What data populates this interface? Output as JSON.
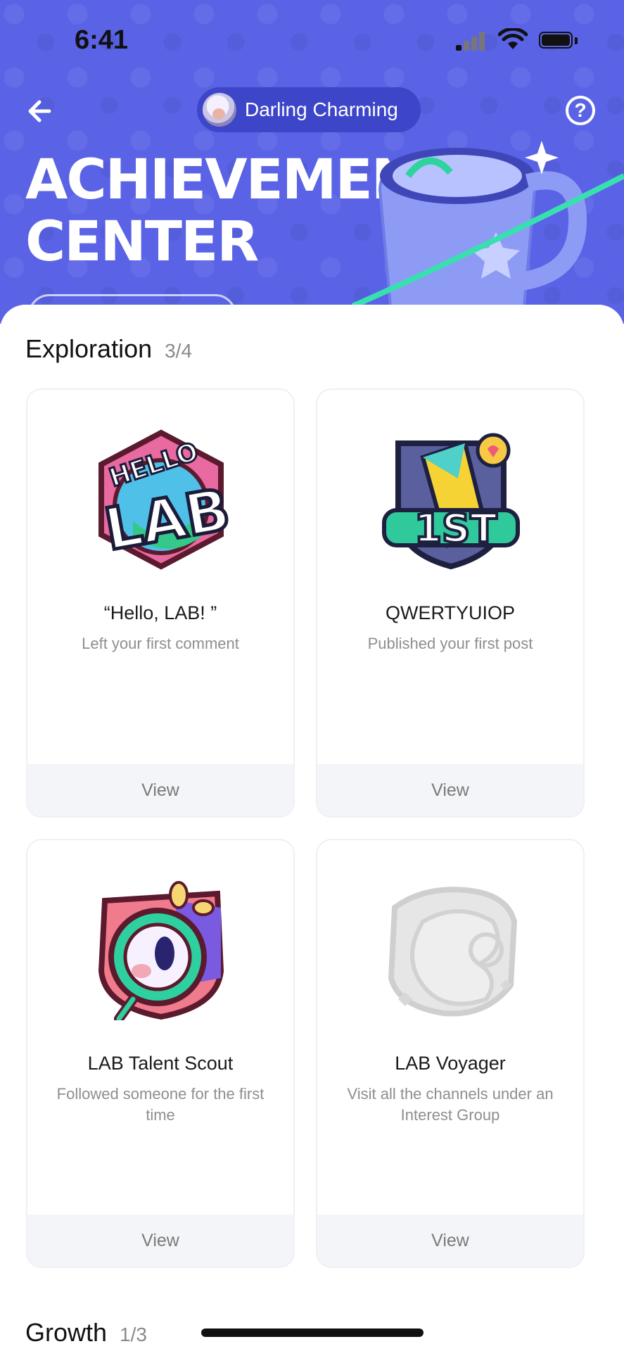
{
  "status": {
    "time": "6:41"
  },
  "header": {
    "user_name": "Darling Charming",
    "title": "ACHIEVEMENT\nCENTER",
    "background_color": "#5a63e6"
  },
  "sections": [
    {
      "title": "Exploration",
      "count": "3/4",
      "cards": [
        {
          "name": "“Hello, LAB! ”",
          "desc": "Left your first comment",
          "view_label": "View",
          "badge_icon": "hello-lab-badge"
        },
        {
          "name": "QWERTYUIOP",
          "desc": "Published your first post",
          "view_label": "View",
          "badge_icon": "first-post-badge"
        },
        {
          "name": "LAB Talent Scout",
          "desc": "Followed someone for the first time",
          "view_label": "View",
          "badge_icon": "talent-scout-badge"
        },
        {
          "name": "LAB Voyager",
          "desc": "Visit all the channels under an Interest Group",
          "view_label": "View",
          "badge_icon": "voyager-badge-locked"
        }
      ]
    },
    {
      "title": "Growth",
      "count": "1/3"
    }
  ]
}
